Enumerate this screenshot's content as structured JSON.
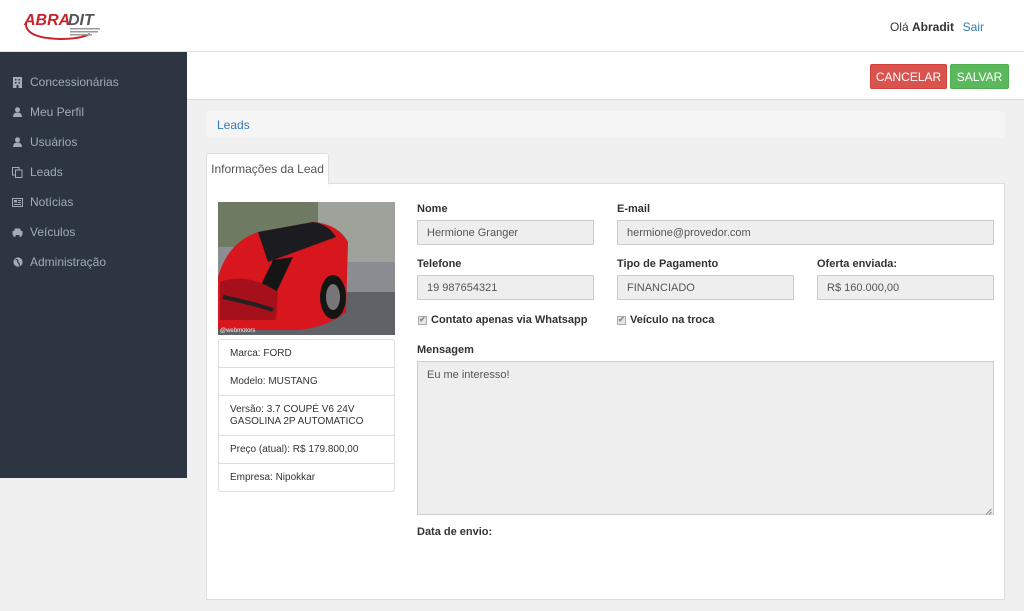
{
  "header": {
    "logo_text": "ABRADIT",
    "greeting_prefix": "Olá",
    "user_name": "Abradit",
    "logout_label": "Sair"
  },
  "sidebar": {
    "items": [
      {
        "label": "Concessionárias",
        "icon": "building-icon"
      },
      {
        "label": "Meu Perfil",
        "icon": "user-icon"
      },
      {
        "label": "Usuários",
        "icon": "users-icon"
      },
      {
        "label": "Leads",
        "icon": "copy-icon"
      },
      {
        "label": "Notícias",
        "icon": "newspaper-icon"
      },
      {
        "label": "Veículos",
        "icon": "car-icon"
      },
      {
        "label": "Administração",
        "icon": "globe-icon"
      }
    ]
  },
  "actions": {
    "cancel_label": "CANCELAR",
    "save_label": "SALVAR"
  },
  "breadcrumb": {
    "label": "Leads"
  },
  "tabs": [
    {
      "label": "Informações da Lead"
    }
  ],
  "vehicle": {
    "photo_watermark": "@webmotors",
    "details": [
      "Marca: FORD",
      "Modelo: MUSTANG",
      "Versão: 3.7 COUPÉ V6 24V GASOLINA 2P AUTOMATICO",
      "Preço (atual): R$ 179.800,00",
      "Empresa: Nipokkar"
    ]
  },
  "form": {
    "nome": {
      "label": "Nome",
      "value": "Hermione Granger"
    },
    "email": {
      "label": "E-mail",
      "value": "hermione@provedor.com"
    },
    "telefone": {
      "label": "Telefone",
      "value": "19 987654321"
    },
    "tipo_pagamento": {
      "label": "Tipo de Pagamento",
      "value": "FINANCIADO"
    },
    "oferta": {
      "label": "Oferta enviada:",
      "value": "R$ 160.000,00"
    },
    "whatsapp": {
      "label": "Contato apenas via Whatsapp",
      "checked": true
    },
    "troca": {
      "label": "Veículo na troca",
      "checked": true
    },
    "mensagem": {
      "label": "Mensagem",
      "value": "Eu me interesso!"
    },
    "data_envio": {
      "label": "Data de envio:"
    }
  },
  "colors": {
    "sidebar_bg": "#2c3541",
    "cancel": "#d9534f",
    "save": "#5cb85c",
    "link": "#337ab7",
    "brand_red": "#c8232c"
  }
}
